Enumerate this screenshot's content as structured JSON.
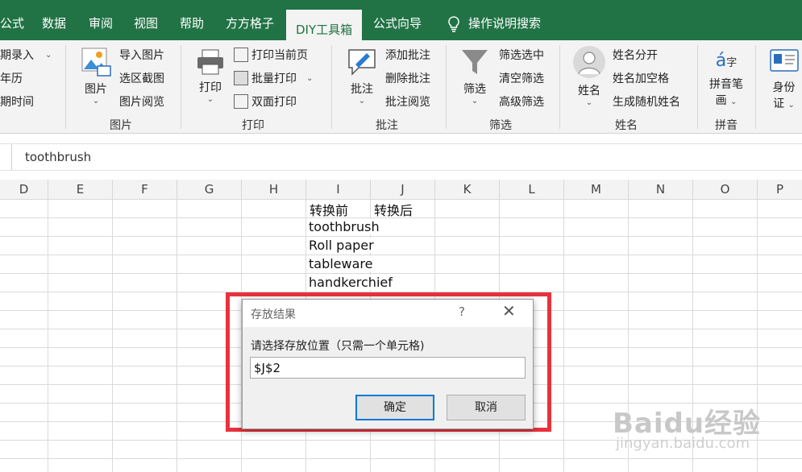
{
  "tabs": [
    "公式",
    "数据",
    "审阅",
    "视图",
    "帮助",
    "方方格子",
    "DIY工具箱",
    "公式向导"
  ],
  "active_tab": "DIY工具箱",
  "tell_me": "操作说明搜索",
  "ribbon": {
    "left_partial": [
      "期录入",
      "年历",
      "期时间"
    ],
    "picture_group": {
      "big": "图片",
      "items": [
        "导入图片",
        "选区截图",
        "图片阅览"
      ],
      "label": "图片"
    },
    "print_group": {
      "big": "打印",
      "items": [
        "打印当前页",
        "批量打印",
        "双面打印"
      ],
      "label": "打印"
    },
    "comment_group": {
      "big": "批注",
      "items": [
        "添加批注",
        "删除批注",
        "批注阅览"
      ],
      "label": "批注"
    },
    "filter_group": {
      "big": "筛选",
      "items": [
        "筛选选中",
        "清空筛选",
        "高级筛选"
      ],
      "label": "筛选"
    },
    "name_group": {
      "big": "姓名",
      "items": [
        "姓名分开",
        "姓名加空格",
        "生成随机姓名"
      ],
      "label": "姓名"
    },
    "pinyin_group": {
      "big1": "拼音笔",
      "big2": "画",
      "label": "拼音"
    },
    "id_group": {
      "big1": "身份",
      "big2": "证"
    }
  },
  "formula_bar": {
    "value": "toothbrush"
  },
  "columns": [
    "D",
    "E",
    "F",
    "G",
    "H",
    "I",
    "J",
    "K",
    "L",
    "M",
    "N",
    "O",
    "P"
  ],
  "cells": {
    "i1": "转换前",
    "j1": "转换后",
    "i2": "toothbrush",
    "i3": "Roll paper",
    "i4": "tableware",
    "i5": "handkerchief"
  },
  "dialog": {
    "title": "存放结果",
    "help": "?",
    "close": "✕",
    "prompt": "请选择存放位置（只需一个单元格)",
    "input_value": "$J$2",
    "ok": "确定",
    "cancel": "取消"
  },
  "watermark": {
    "main": "Baidu经验",
    "sub": "jingyan.baidu.com"
  }
}
